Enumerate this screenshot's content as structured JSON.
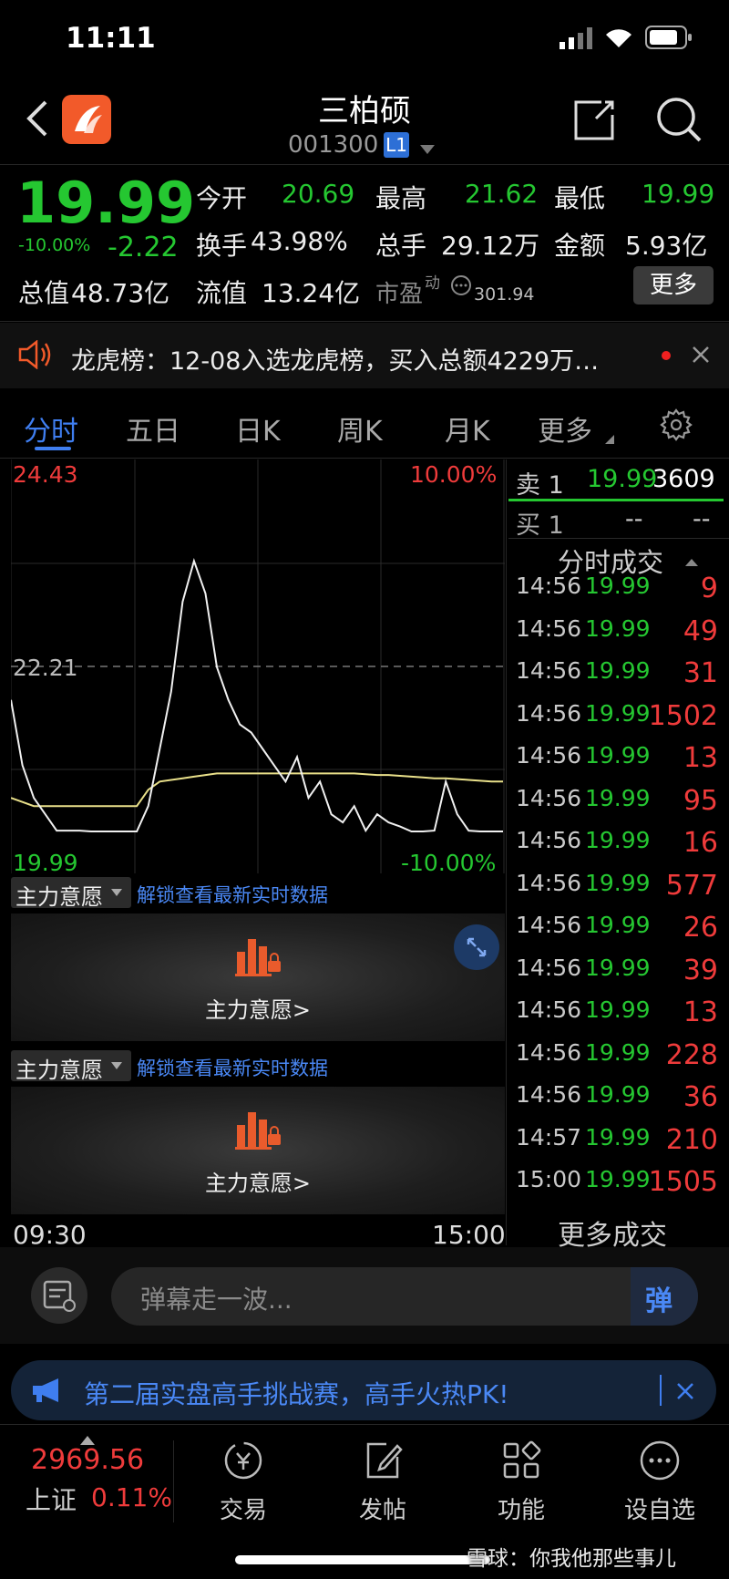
{
  "status_bar": {
    "time": "11:11"
  },
  "header": {
    "title": "三柏硕",
    "code": "001300",
    "level_badge": "L1"
  },
  "quote": {
    "price": "19.99",
    "change_pct": "-10.00%",
    "change": "-2.22",
    "open_label": "今开",
    "open": "20.69",
    "high_label": "最高",
    "high": "21.62",
    "low_label": "最低",
    "low": "19.99",
    "turnover_label": "换手",
    "turnover": "43.98%",
    "volume_label": "总手",
    "volume": "29.12万",
    "amount_label": "金额",
    "amount": "5.93亿",
    "mktcap_label": "总值",
    "mktcap": "48.73亿",
    "float_label": "流值",
    "float_cap": "13.24亿",
    "pe_label": "市盈",
    "pe_sup": "动",
    "pe": "301.94",
    "more_button": "更多"
  },
  "notice": {
    "text": "龙虎榜：12-08入选龙虎榜，买入总额4229万…"
  },
  "tabs": [
    "分时",
    "五日",
    "日K",
    "周K",
    "月K",
    "更多"
  ],
  "chart": {
    "y_top": "24.43",
    "y_mid": "22.21",
    "y_bottom": "19.99",
    "pct_top": "10.00%",
    "pct_bottom": "-10.00%",
    "x_start": "09:30",
    "x_end": "15:00"
  },
  "chart_data": {
    "type": "line",
    "title": "",
    "ylim": [
      19.99,
      24.43
    ],
    "x_range": [
      "09:30",
      "15:00"
    ],
    "series": [
      {
        "values": [
          21.6,
          20.8,
          20.4,
          20.2,
          20.0,
          20.0,
          20.0,
          19.99,
          19.99,
          19.99,
          19.99,
          19.99,
          20.3,
          21.0,
          21.7,
          22.8,
          23.3,
          22.9,
          22.0,
          21.6,
          21.3,
          21.2,
          21.0,
          20.8,
          20.6,
          20.9,
          20.4,
          20.6,
          20.2,
          20.1,
          20.3,
          20.0,
          20.2,
          20.1,
          20.05,
          19.99,
          19.99,
          20.0,
          20.6,
          20.2,
          20.0,
          19.99,
          19.99,
          19.99
        ]
      },
      {
        "values": [
          20.4,
          20.35,
          20.3,
          20.3,
          20.3,
          20.3,
          20.3,
          20.3,
          20.3,
          20.3,
          20.3,
          20.3,
          20.5,
          20.6,
          20.62,
          20.64,
          20.66,
          20.68,
          20.7,
          20.7,
          20.7,
          20.7,
          20.7,
          20.7,
          20.7,
          20.7,
          20.7,
          20.7,
          20.7,
          20.7,
          20.7,
          20.69,
          20.68,
          20.68,
          20.67,
          20.66,
          20.65,
          20.64,
          20.64,
          20.63,
          20.62,
          20.61,
          20.6,
          20.6
        ]
      }
    ]
  },
  "sub_panels": {
    "label": "主力意愿",
    "unlock_text": "解锁查看最新实时数据",
    "center_text": "主力意愿>"
  },
  "order_book": {
    "sell1_label": "卖 1",
    "sell1_price": "19.99",
    "sell1_vol": "3609",
    "buy1_label": "买 1",
    "buy1_price": "--",
    "buy1_vol": "--"
  },
  "ticks": {
    "title": "分时成交",
    "rows": [
      {
        "time": "14:56",
        "price": "19.99",
        "vol": "9"
      },
      {
        "time": "14:56",
        "price": "19.99",
        "vol": "49"
      },
      {
        "time": "14:56",
        "price": "19.99",
        "vol": "31"
      },
      {
        "time": "14:56",
        "price": "19.99",
        "vol": "1502"
      },
      {
        "time": "14:56",
        "price": "19.99",
        "vol": "13"
      },
      {
        "time": "14:56",
        "price": "19.99",
        "vol": "95"
      },
      {
        "time": "14:56",
        "price": "19.99",
        "vol": "16"
      },
      {
        "time": "14:56",
        "price": "19.99",
        "vol": "577"
      },
      {
        "time": "14:56",
        "price": "19.99",
        "vol": "26"
      },
      {
        "time": "14:56",
        "price": "19.99",
        "vol": "39"
      },
      {
        "time": "14:56",
        "price": "19.99",
        "vol": "13"
      },
      {
        "time": "14:56",
        "price": "19.99",
        "vol": "228"
      },
      {
        "time": "14:56",
        "price": "19.99",
        "vol": "36"
      },
      {
        "time": "14:57",
        "price": "19.99",
        "vol": "210"
      },
      {
        "time": "15:00",
        "price": "19.99",
        "vol": "1505"
      }
    ],
    "more": "更多成交"
  },
  "comment": {
    "placeholder": "弹幕走一波...",
    "send": "弹"
  },
  "promo": {
    "text": "第二届实盘高手挑战赛，高手火热PK!"
  },
  "index": {
    "value": "2969.56",
    "name": "上证",
    "pct": "0.11%"
  },
  "bottom_nav": [
    {
      "label": "交易",
      "icon": "trade-icon"
    },
    {
      "label": "发帖",
      "icon": "post-icon"
    },
    {
      "label": "功能",
      "icon": "grid-icon"
    },
    {
      "label": "设自选",
      "icon": "more-icon"
    }
  ],
  "watermark": "雪球：你我他那些事儿"
}
